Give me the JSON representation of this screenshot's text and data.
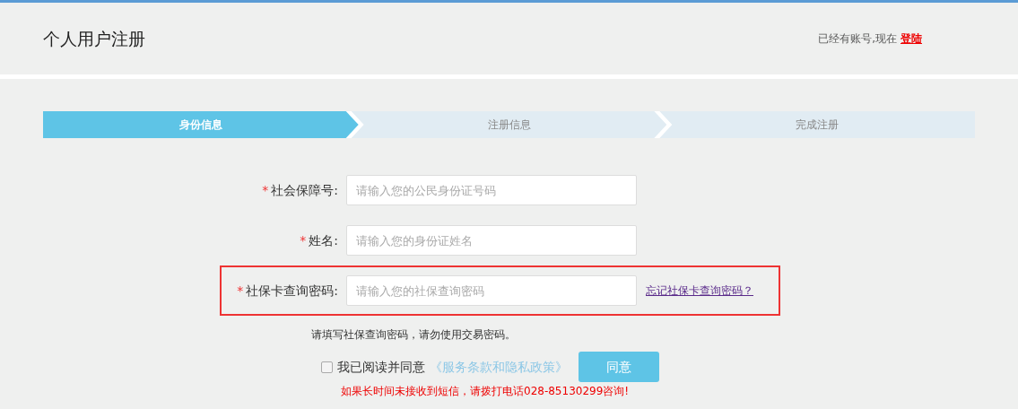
{
  "header": {
    "title": "个人用户注册",
    "login_prompt": "已经有账号,现在",
    "login_link": "登陆"
  },
  "steps": [
    {
      "label": "身份信息",
      "selected": true
    },
    {
      "label": "注册信息",
      "selected": false
    },
    {
      "label": "完成注册",
      "selected": false
    }
  ],
  "fields": [
    {
      "label": "社会保障号:",
      "required_mark": "*",
      "placeholder": "请输入您的公民身份证号码",
      "highlighted": false
    },
    {
      "label": "姓名:",
      "required_mark": "*",
      "placeholder": "请输入您的身份证姓名",
      "highlighted": false
    },
    {
      "label": "社保卡查询密码:",
      "required_mark": "*",
      "placeholder": "请输入您的社保查询密码",
      "highlighted": true,
      "link": "忘记社保卡查询密码？"
    }
  ],
  "hint": "请填写社保查询密码，请勿使用交易密码。",
  "agreement": {
    "checked": false,
    "label": "我已阅读并同意",
    "policy_link": "《服务条款和隐私政策》",
    "button": "同意"
  },
  "notice": "如果长时间未接收到短信，请拨打电话028-85130299咨询!"
}
